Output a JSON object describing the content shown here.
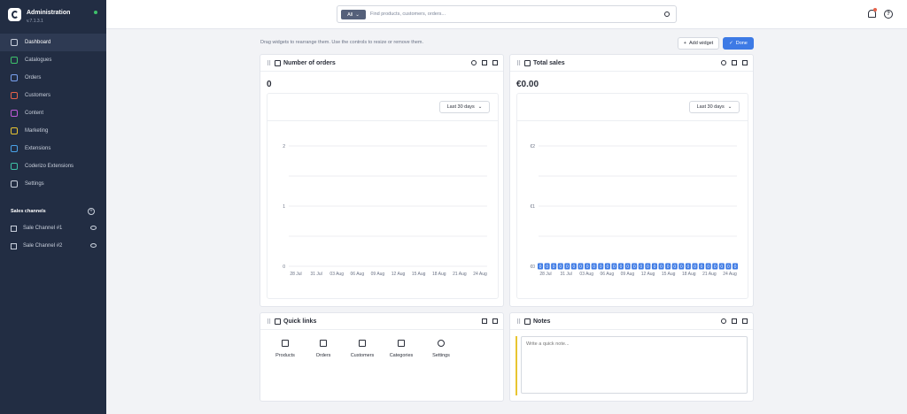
{
  "app": {
    "title": "Administration",
    "version": "v.7.1.3.1"
  },
  "nav": [
    {
      "label": "Dashboard",
      "icon": "dashboard-icon",
      "active": true
    },
    {
      "label": "Catalogues",
      "icon": "catalogue-icon"
    },
    {
      "label": "Orders",
      "icon": "orders-icon"
    },
    {
      "label": "Customers",
      "icon": "customers-icon"
    },
    {
      "label": "Content",
      "icon": "content-icon"
    },
    {
      "label": "Marketing",
      "icon": "marketing-icon"
    },
    {
      "label": "Extensions",
      "icon": "extensions-icon"
    },
    {
      "label": "Coderizo Extensions",
      "icon": "extensions-icon"
    },
    {
      "label": "Settings",
      "icon": "settings-icon"
    }
  ],
  "nav_icon_colors": [
    "#c9d0dc",
    "#3ec26b",
    "#7aa2f0",
    "#e7624a",
    "#c05ad8",
    "#e8c531",
    "#4aa3e8",
    "#3ec2a6",
    "#c9d0dc"
  ],
  "sales_channels": {
    "heading": "Sales channels",
    "items": [
      {
        "label": "Sale Channel #1"
      },
      {
        "label": "Sale Channel #2"
      }
    ]
  },
  "search": {
    "filter": "All",
    "placeholder": "Find products, customers, orders..."
  },
  "toolbar": {
    "hint": "Drag widgets to rearrange them. Use the controls to resize or remove them.",
    "add_widget": "Add widget",
    "done": "Done"
  },
  "widgets": {
    "orders": {
      "title": "Number of orders",
      "value": "0",
      "range": "Last 30 days"
    },
    "sales": {
      "title": "Total sales",
      "value": "€0.00",
      "range": "Last 30 days"
    },
    "quick_links": {
      "title": "Quick links",
      "items": [
        "Products",
        "Orders",
        "Customers",
        "Categories",
        "Settings"
      ]
    },
    "notes": {
      "title": "Notes",
      "placeholder": "Write a quick note..."
    }
  },
  "chart_data": [
    {
      "type": "line",
      "title": "Number of orders",
      "categories": [
        "28 Jul",
        "31 Jul",
        "03 Aug",
        "06 Aug",
        "09 Aug",
        "12 Aug",
        "15 Aug",
        "18 Aug",
        "21 Aug",
        "24 Aug"
      ],
      "yticks": [
        "0",
        "1",
        "2"
      ],
      "ylim": [
        0,
        2
      ],
      "series": []
    },
    {
      "type": "line",
      "title": "Total sales",
      "categories": [
        "28 Jul",
        "31 Jul",
        "03 Aug",
        "06 Aug",
        "09 Aug",
        "12 Aug",
        "15 Aug",
        "18 Aug",
        "21 Aug",
        "24 Aug"
      ],
      "yticks": [
        "€0",
        "€1",
        "€2"
      ],
      "ylim": [
        0,
        2
      ],
      "series": [
        {
          "values": [
            0,
            0,
            0,
            0,
            0,
            0,
            0,
            0,
            0,
            0,
            0,
            0,
            0,
            0,
            0,
            0,
            0,
            0,
            0,
            0,
            0,
            0,
            0,
            0,
            0,
            0,
            0,
            0,
            0,
            0
          ],
          "point_label": "0"
        }
      ],
      "color": "#3d7ae5"
    }
  ]
}
